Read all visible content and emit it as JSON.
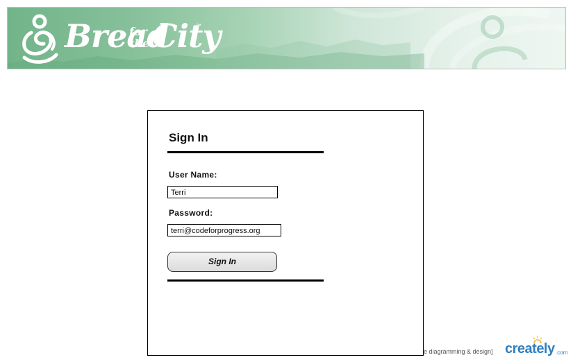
{
  "banner": {
    "logo_main": "Bread",
    "logo_small_line1": "for",
    "logo_small_line2": "the",
    "logo_city": "City",
    "logo_tm": "™",
    "brand_colors": {
      "green_dark": "#72b48a",
      "green_light": "#eef6f1"
    }
  },
  "signin": {
    "title": "Sign In",
    "username_label": "User Name:",
    "username_value": "Terri",
    "password_label": "Password:",
    "password_value": "terri@codeforprogress.org",
    "button_label": "Sign In"
  },
  "footer": {
    "tagline": "e diagramming & design]",
    "brand": "creately",
    "brand_suffix": ".com",
    "brand_color": "#2f7fbf"
  }
}
